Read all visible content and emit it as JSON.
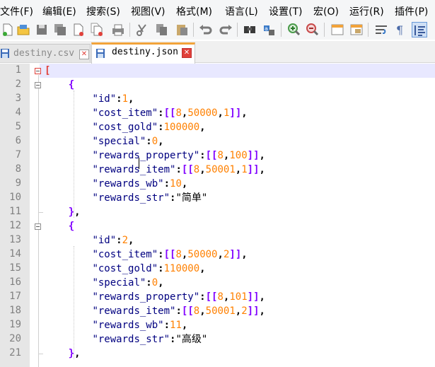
{
  "menu": [
    "文件(F)",
    "编辑(E)",
    "搜索(S)",
    "视图(V)",
    "格式(M)",
    "语言(L)",
    "设置(T)",
    "宏(O)",
    "运行(R)",
    "插件(P)"
  ],
  "toolbar_icons": [
    "new-file-icon",
    "open-file-icon",
    "save-icon",
    "save-all-icon",
    "close-icon",
    "close-all-icon",
    "print-icon",
    "cut-icon",
    "copy-icon",
    "paste-icon",
    "undo-icon",
    "redo-icon",
    "find-icon",
    "replace-icon",
    "zoom-in-icon",
    "zoom-out-icon",
    "sync-vertical-icon",
    "sync-horizontal-icon",
    "word-wrap-icon",
    "show-all-chars-icon",
    "indent-guide-icon"
  ],
  "tabs": [
    {
      "label": "destiny.csv",
      "active": false
    },
    {
      "label": "destiny.json",
      "active": true
    }
  ],
  "colors": {
    "accent": "#f2a33a",
    "keyword": "#000080",
    "number": "#ff8000",
    "bracket": "#8000ff",
    "fold_marker": "#e0403a"
  },
  "lines": [
    {
      "num": "1",
      "code": "["
    },
    {
      "num": "2",
      "code": "    {"
    },
    {
      "num": "3",
      "code": "        \"id\":1,"
    },
    {
      "num": "4",
      "code": "        \"cost_item\":[[8,50000,1]],"
    },
    {
      "num": "5",
      "code": "        \"cost_gold\":100000,"
    },
    {
      "num": "6",
      "code": "        \"special\":0,"
    },
    {
      "num": "7",
      "code": "        \"rewards_property\":[[8,100]],"
    },
    {
      "num": "8",
      "code": "        \"rewards_item\":[[8,50001,1]],"
    },
    {
      "num": "9",
      "code": "        \"rewards_wb\":10,"
    },
    {
      "num": "10",
      "code": "        \"rewards_str\":\"简单\""
    },
    {
      "num": "11",
      "code": "    },"
    },
    {
      "num": "12",
      "code": "    {"
    },
    {
      "num": "13",
      "code": "        \"id\":2,"
    },
    {
      "num": "14",
      "code": "        \"cost_item\":[[8,50000,2]],"
    },
    {
      "num": "15",
      "code": "        \"cost_gold\":110000,"
    },
    {
      "num": "16",
      "code": "        \"special\":0,"
    },
    {
      "num": "17",
      "code": "        \"rewards_property\":[[8,101]],"
    },
    {
      "num": "18",
      "code": "        \"rewards_item\":[[8,50001,2]],"
    },
    {
      "num": "19",
      "code": "        \"rewards_wb\":11,"
    },
    {
      "num": "20",
      "code": "        \"rewards_str\":\"高级\""
    },
    {
      "num": "21",
      "code": "    },"
    }
  ]
}
